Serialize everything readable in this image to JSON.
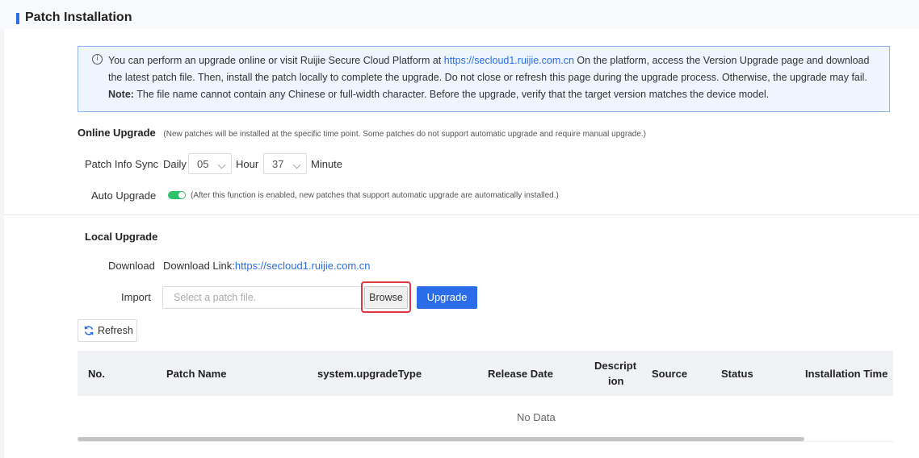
{
  "page": {
    "title": "Patch Installation"
  },
  "notice": {
    "icon": "info-icon",
    "text1": "You can perform an upgrade online or visit Ruijie Secure Cloud Platform at ",
    "link": "https://secloud1.ruijie.com.cn",
    "text2": " On the platform, access the Version Upgrade page and download the latest patch file. Then, install the patch locally to complete the upgrade. Do not close or refresh this page during the upgrade process. Otherwise, the upgrade may fail. ",
    "note_label": "Note:",
    "text3": " The file name cannot contain any Chinese or full-width character. Before the upgrade, verify that the target version matches the device model."
  },
  "online": {
    "title": "Online Upgrade",
    "note": "(New patches will be installed at the specific time point. Some patches do not support automatic upgrade and require manual upgrade.)",
    "sync_label": "Patch Info Sync",
    "daily": "Daily",
    "hour_value": "05",
    "hour_label": "Hour",
    "minute_value": "37",
    "minute_label": "Minute",
    "auto_label": "Auto Upgrade",
    "auto_enabled": true,
    "auto_note": "(After this function is enabled, new patches that support automatic upgrade are automatically installed.)"
  },
  "local": {
    "title": "Local Upgrade",
    "download_label": "Download",
    "download_text": "Download Link:",
    "download_link": "https://secloud1.ruijie.com.cn",
    "import_label": "Import",
    "placeholder": "Select a patch file.",
    "browse": "Browse",
    "upgrade": "Upgrade"
  },
  "refresh": "Refresh",
  "table": {
    "columns": [
      "No.",
      "Patch Name",
      "system.upgradeType",
      "Release Date",
      "Descript",
      "ion",
      "Source",
      "Status",
      "Installation Time"
    ],
    "empty": "No Data"
  },
  "colors": {
    "accent": "#2b6de8",
    "toggle_on": "#2ec26a",
    "highlight": "#e0383e"
  }
}
